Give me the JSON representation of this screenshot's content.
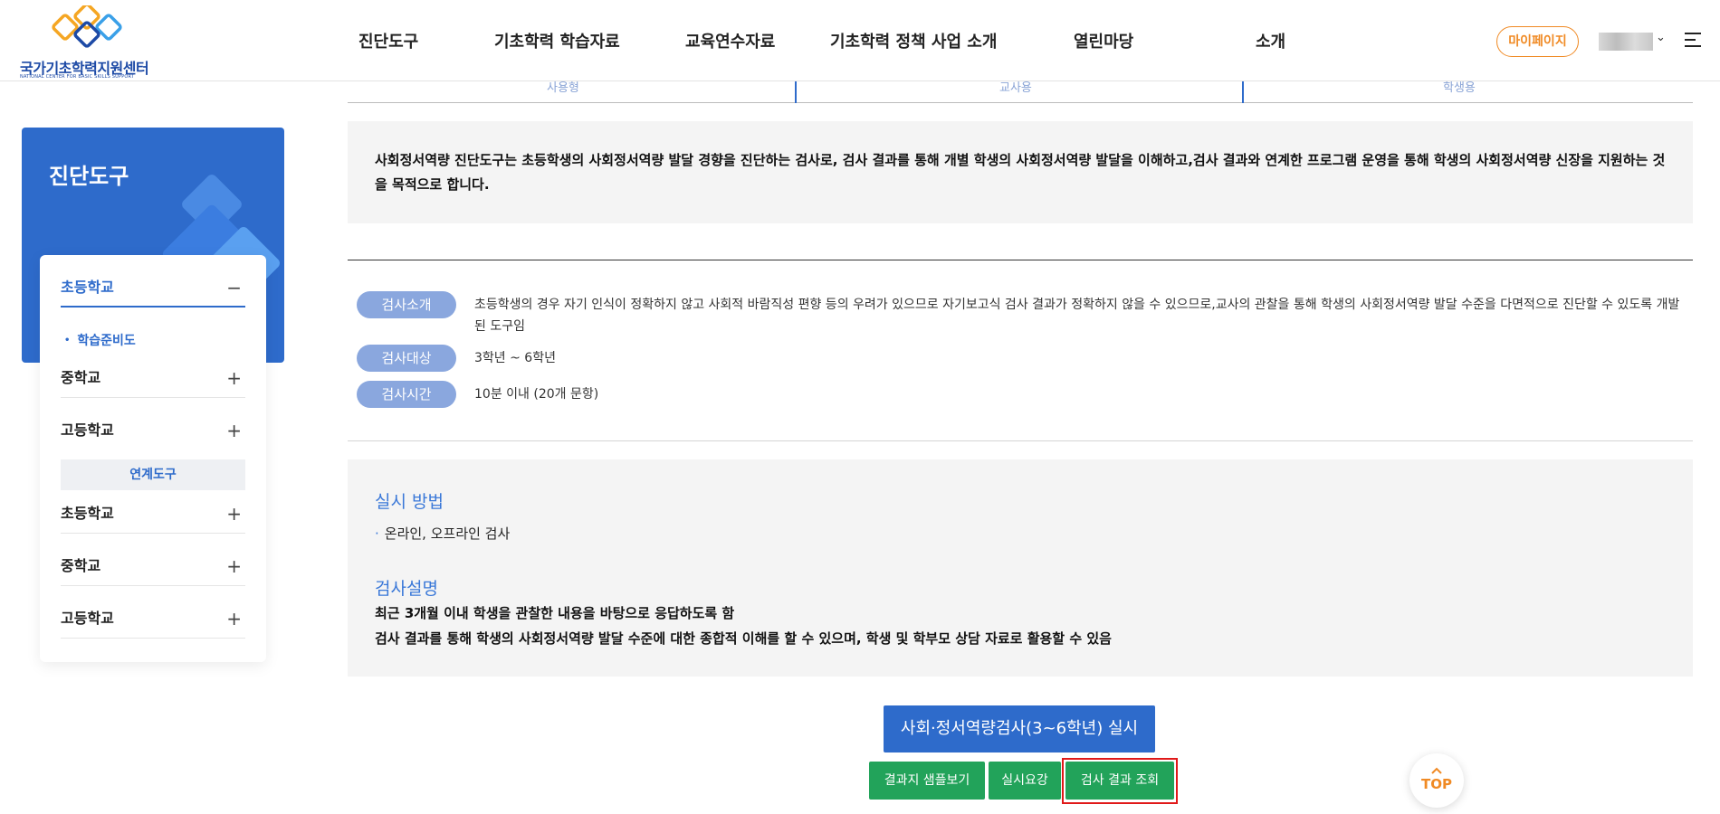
{
  "brand": {
    "title": "국가기초학력지원센터",
    "subtitle": "NATIONAL CENTER FOR BASIC SKILLS SUPPORT"
  },
  "gnb": [
    "진단도구",
    "기초학력 학습자료",
    "교육연수자료",
    "기초학력 정책 사업 소개",
    "열린마당",
    "소개"
  ],
  "header": {
    "mypage_label": "마이페이지"
  },
  "sidebar": {
    "banner_title": "진단도구",
    "items": [
      {
        "label": "초등학교",
        "sign": "−"
      },
      {
        "label": "학습준비도"
      },
      {
        "label": "중학교",
        "sign": "+"
      },
      {
        "label": "고등학교",
        "sign": "+"
      },
      {
        "label": "연계도구"
      },
      {
        "label": "초등학교",
        "sign": "+"
      },
      {
        "label": "중학교",
        "sign": "+"
      },
      {
        "label": "고등학교",
        "sign": "+"
      }
    ]
  },
  "tabs_fragments": [
    "사용형",
    "교사용",
    "학생용"
  ],
  "intro": "사회정서역량 진단도구는 초등학생의 사회정서역량 발달 경향을 진단하는 검사로, 검사 결과를 통해 개별 학생의 사회정서역량 발달을 이해하고,검사 결과와 연계한 프로그램 운영을 통해 학생의 사회정서역량 신장을 지원하는 것을 목적으로 합니다.",
  "info": [
    {
      "label": "검사소개",
      "text": "초등학생의 경우 자기 인식이 정확하지 않고 사회적 바람직성 편향 등의 우려가 있으므로 자기보고식 검사 결과가 정확하지 않을 수 있으므로,교사의 관찰을 통해 학생의 사회정서역량 발달 수준을 다면적으로 진단할 수 있도록 개발된 도구임"
    },
    {
      "label": "검사대상",
      "text": "3학년 ~ 6학년"
    },
    {
      "label": "검사시간",
      "text": "10분 이내 (20개 문항)"
    }
  ],
  "method": {
    "title": "실시 방법",
    "bullet": "온라인, 오프라인 검사",
    "desc_title": "검사설명",
    "desc_lines": [
      "최근 3개월 이내 학생을 관찰한 내용을 바탕으로 응답하도록 함",
      "검사 결과를 통해 학생의 사회정서역량 발달 수준에 대한 종합적 이해를 할 수 있으며, 학생 및 학부모 상담 자료로 활용할 수 있음"
    ]
  },
  "buttons": {
    "start": "사회·정서역량검사(3~6학년) 실시",
    "sample": "결과지 샘플보기",
    "guide": "실시요강",
    "result": "검사 결과 조회",
    "top": "TOP"
  },
  "colors": {
    "primary": "#2e6bcb",
    "green": "#22a35a",
    "orange": "#f08a24",
    "highlight": "#e01919"
  }
}
